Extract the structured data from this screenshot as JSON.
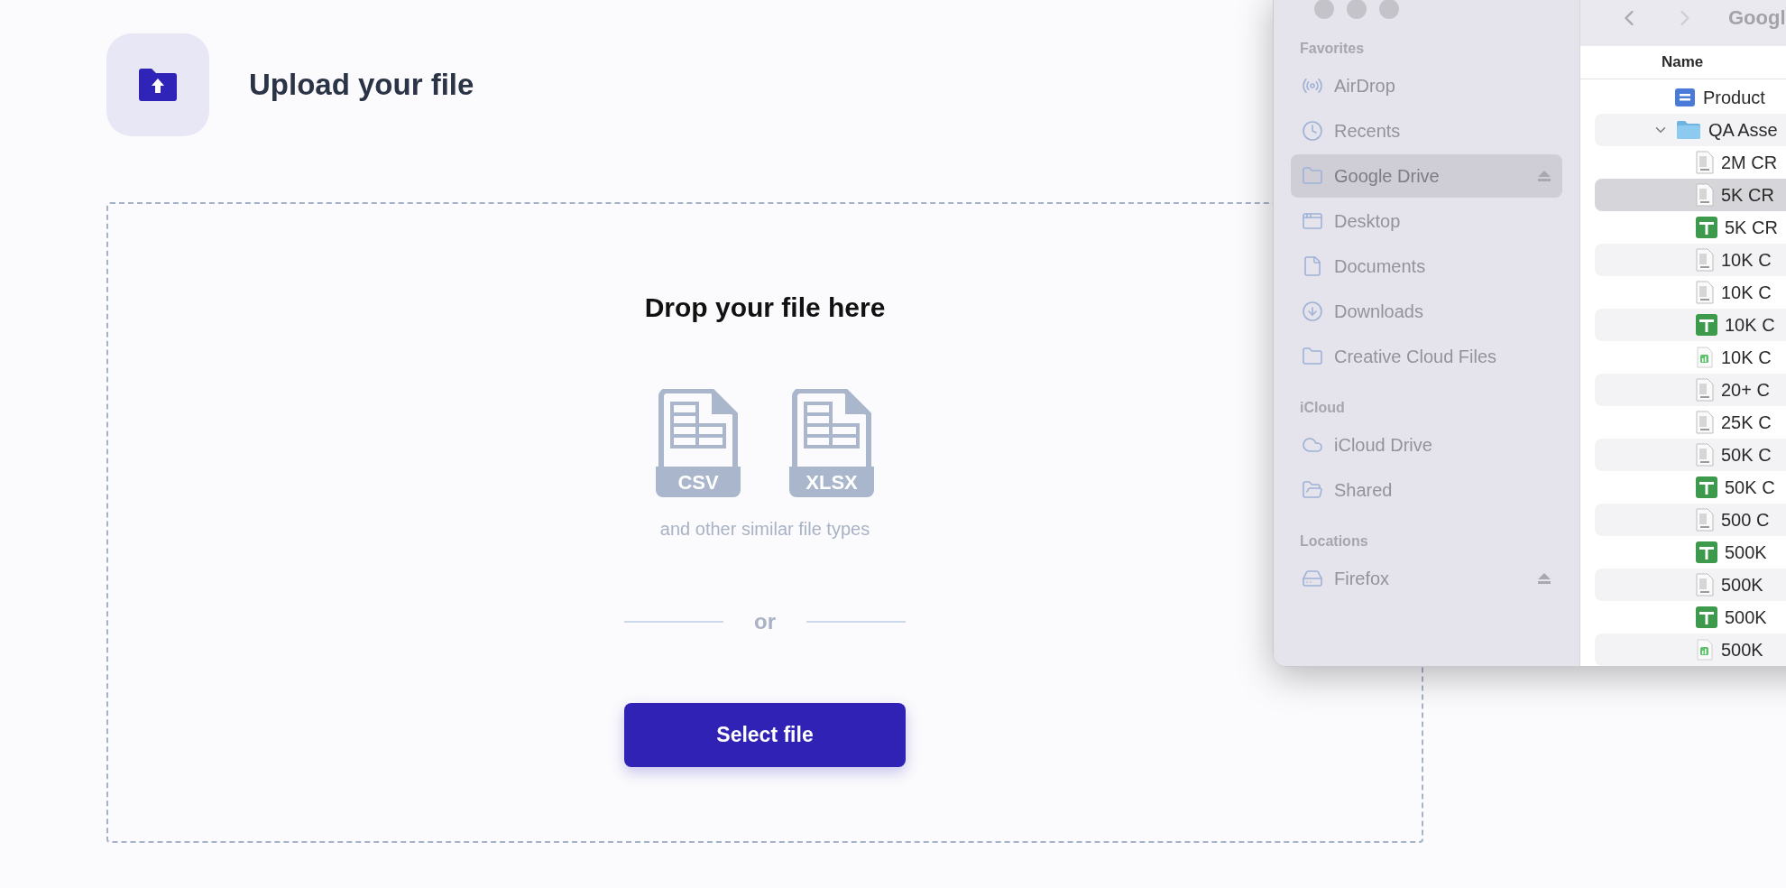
{
  "page": {
    "title": "Upload your file"
  },
  "dropzone": {
    "heading": "Drop your file here",
    "file_types": [
      {
        "label": "CSV"
      },
      {
        "label": "XLSX"
      }
    ],
    "note": "and other similar file types",
    "separator": "or",
    "button": "Select file"
  },
  "finder": {
    "path_title": "Googl",
    "sidebar": [
      {
        "heading": "Favorites",
        "items": [
          {
            "label": "AirDrop",
            "selected": false,
            "ejectable": false
          },
          {
            "label": "Recents",
            "selected": false,
            "ejectable": false
          },
          {
            "label": "Google Drive",
            "selected": true,
            "ejectable": true
          },
          {
            "label": "Desktop",
            "selected": false,
            "ejectable": false
          },
          {
            "label": "Documents",
            "selected": false,
            "ejectable": false
          },
          {
            "label": "Downloads",
            "selected": false,
            "ejectable": false
          },
          {
            "label": "Creative Cloud Files",
            "selected": false,
            "ejectable": false
          }
        ]
      },
      {
        "heading": "iCloud",
        "items": [
          {
            "label": "iCloud Drive",
            "selected": false,
            "ejectable": false
          },
          {
            "label": "Shared",
            "selected": false,
            "ejectable": false
          }
        ]
      },
      {
        "heading": "Locations",
        "items": [
          {
            "label": "Firefox",
            "selected": false,
            "ejectable": true
          }
        ]
      }
    ],
    "columns": [
      "Name"
    ],
    "files": [
      {
        "name": "Product",
        "kind": "doc",
        "selected": false
      },
      {
        "name": "QA Asse",
        "kind": "folder",
        "selected": false,
        "expanded": true,
        "children": [
          {
            "name": "2M CR",
            "kind": "csv",
            "selected": false
          },
          {
            "name": "5K CR",
            "kind": "csv",
            "selected": true
          },
          {
            "name": "5K CR",
            "kind": "sheet",
            "selected": false
          },
          {
            "name": "10K C",
            "kind": "csv",
            "selected": false
          },
          {
            "name": "10K C",
            "kind": "csv",
            "selected": false
          },
          {
            "name": "10K C",
            "kind": "sheet",
            "selected": false
          },
          {
            "name": "10K C",
            "kind": "numbers",
            "selected": false
          },
          {
            "name": "20+ C",
            "kind": "csv",
            "selected": false
          },
          {
            "name": "25K C",
            "kind": "csv",
            "selected": false
          },
          {
            "name": "50K C",
            "kind": "csv",
            "selected": false
          },
          {
            "name": "50K C",
            "kind": "sheet",
            "selected": false
          },
          {
            "name": "500 C",
            "kind": "csv",
            "selected": false
          },
          {
            "name": "500K",
            "kind": "sheet",
            "selected": false
          },
          {
            "name": "500K",
            "kind": "csv",
            "selected": false
          },
          {
            "name": "500K",
            "kind": "sheet",
            "selected": false
          },
          {
            "name": "500K",
            "kind": "numbers",
            "selected": false
          }
        ]
      }
    ]
  }
}
